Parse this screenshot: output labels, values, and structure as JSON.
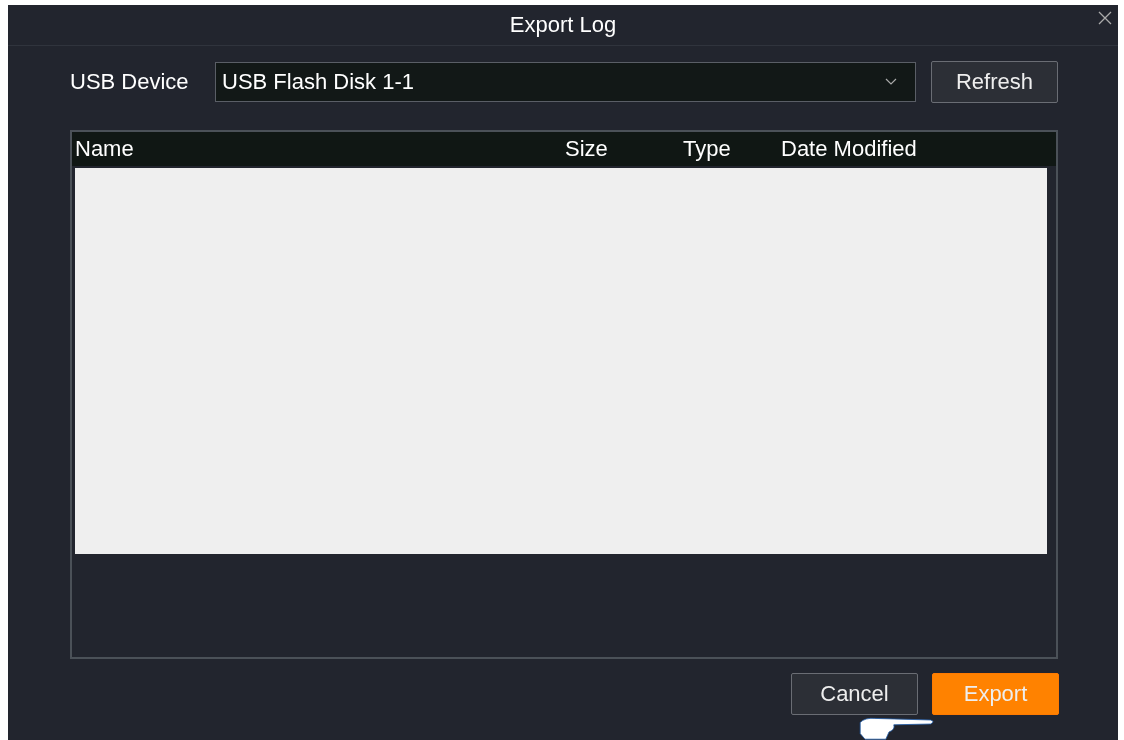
{
  "dialog": {
    "title": "Export Log"
  },
  "usb_device": {
    "label": "USB Device",
    "value": "USB Flash Disk 1-1"
  },
  "refresh_button": "Refresh",
  "table": {
    "columns": [
      "Name",
      "Size",
      "Type",
      "Date Modified"
    ]
  },
  "buttons": [
    {
      "label": "Cancel",
      "kind": "secondary"
    },
    {
      "label": "Export",
      "kind": "primary"
    }
  ]
}
